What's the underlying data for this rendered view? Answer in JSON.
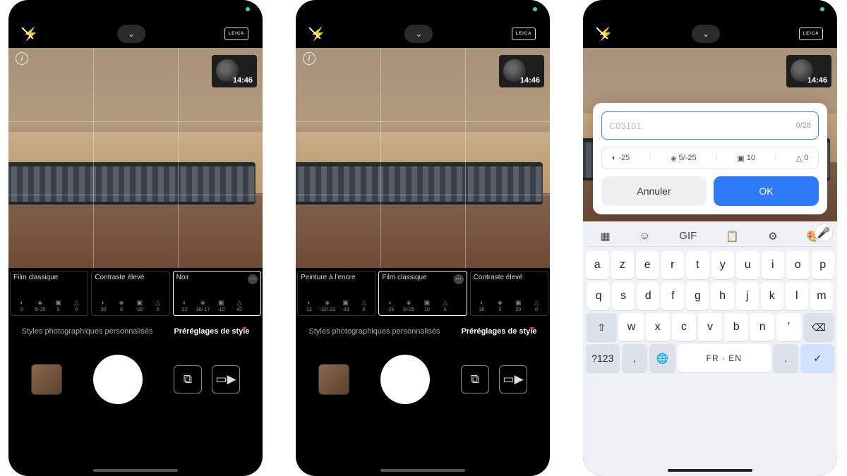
{
  "common": {
    "leica": "LEICA",
    "info_glyph": "i",
    "chevron_glyph": "⌄",
    "flash_glyph": "⚡",
    "globe_time": "14:46",
    "tab_custom": "Styles photographiques personnalisés",
    "tab_presets": "Préréglages de style",
    "switch_glyph": "⧉",
    "video_glyph": "▭▶"
  },
  "screen1": {
    "presets": [
      {
        "title": "Film classique",
        "sel": false,
        "p": [
          "0",
          "5/-25",
          "0",
          "0"
        ]
      },
      {
        "title": "Contraste élevé",
        "sel": false,
        "p": [
          "30",
          "0",
          "-20",
          "0"
        ]
      },
      {
        "title": "Noir",
        "sel": true,
        "p": [
          "22",
          "36/-17",
          "-10",
          "42"
        ]
      }
    ]
  },
  "screen2": {
    "presets": [
      {
        "title": "Peinture à l'encre",
        "sel": false,
        "p": [
          "12",
          "-32/-23",
          "-33",
          "0"
        ]
      },
      {
        "title": "Film classique",
        "sel": true,
        "p": [
          "-25",
          "5/-25",
          "10",
          "0"
        ]
      },
      {
        "title": "Contraste élevé",
        "sel": false,
        "p": [
          "30",
          "0",
          "20",
          "0"
        ]
      }
    ]
  },
  "screen3": {
    "dialog": {
      "placeholder": "C03101",
      "counter": "0/28",
      "params": [
        "-25",
        "5/-25",
        "10",
        "0"
      ],
      "param_icons": [
        "◐",
        "◈",
        "▣",
        "△"
      ],
      "cancel": "Annuler",
      "ok": "OK"
    },
    "keyboard": {
      "top_icons": [
        "▦",
        "☺",
        "GIF",
        "📋",
        "⚙",
        "🎨"
      ],
      "mic": "🎤",
      "row1": [
        "a",
        "z",
        "e",
        "r",
        "t",
        "y",
        "u",
        "i",
        "o",
        "p"
      ],
      "row2": [
        "q",
        "s",
        "d",
        "f",
        "g",
        "h",
        "j",
        "k",
        "l",
        "m"
      ],
      "row3_left": "⇧",
      "row3": [
        "w",
        "x",
        "c",
        "v",
        "b",
        "n",
        "'"
      ],
      "row3_right": "⌫",
      "row4_sym": "?123",
      "row4_emoji": ",",
      "row4_globe": "🌐",
      "space": "FR · EN",
      "row4_dot": ".",
      "row4_enter": "✓"
    }
  }
}
